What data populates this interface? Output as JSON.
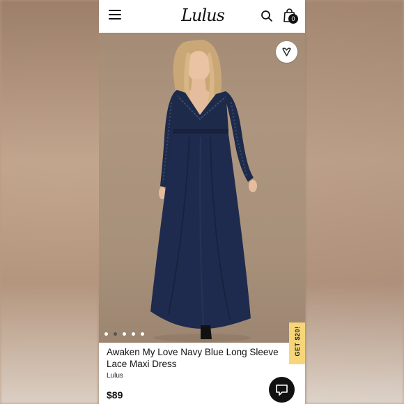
{
  "header": {
    "logo_text": "Lulus",
    "bag_count": "0"
  },
  "product": {
    "title": "Awaken My Love Navy Blue Long Sleeve Lace Maxi Dress",
    "brand": "Lulus",
    "price": "$89"
  },
  "gallery": {
    "image_count": 5,
    "active_index": 1
  },
  "promo_tab": {
    "label": "GET $20!"
  },
  "icons": {
    "menu": "hamburger-icon",
    "search": "search-icon",
    "bag": "shopping-bag-icon",
    "favorite": "heart-icon",
    "chat": "chat-icon"
  },
  "colors": {
    "dress": "#1e2a4a",
    "promo_tab": "#f7d67a",
    "hero_bg": "#a8917b"
  }
}
